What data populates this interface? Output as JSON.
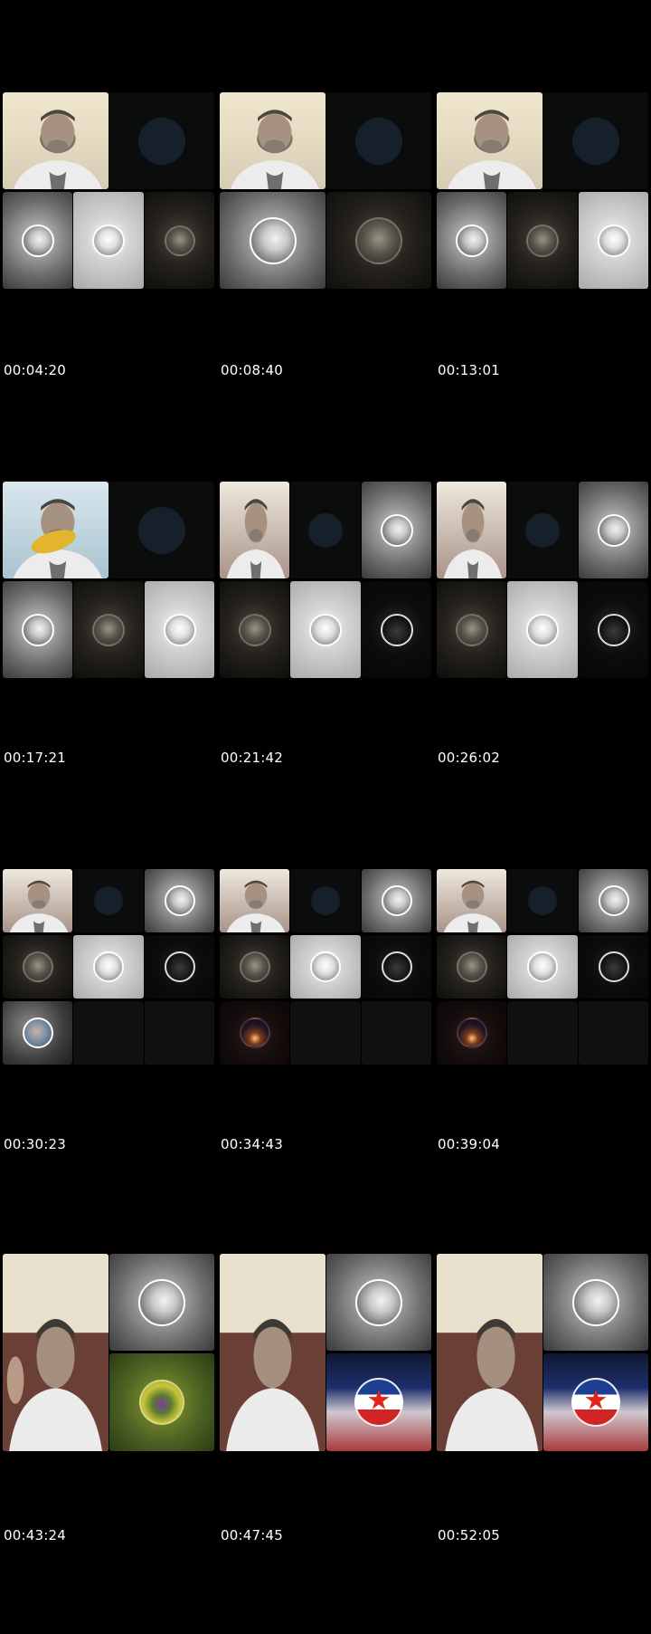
{
  "timestamps": [
    "00:04:20",
    "00:08:40",
    "00:13:01",
    "00:17:21",
    "00:21:42",
    "00:26:02",
    "00:30:23",
    "00:34:43",
    "00:39:04",
    "00:43:24",
    "00:47:45",
    "00:52:05"
  ],
  "icons": {
    "star": "★"
  }
}
